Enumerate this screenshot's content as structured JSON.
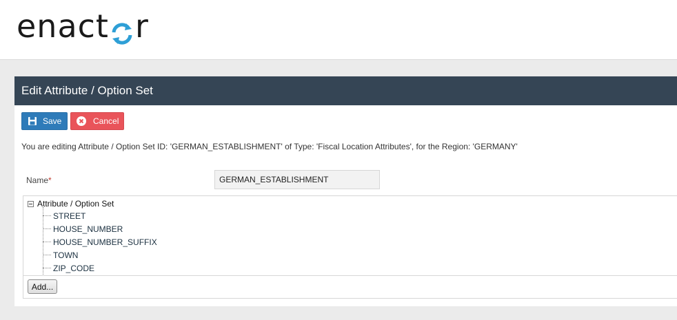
{
  "brand": {
    "logo_text_left": "enact",
    "logo_text_right": "r",
    "logo_color": "#1a1a1a",
    "logo_accent": "#2e9fd6"
  },
  "panel": {
    "title": "Edit Attribute / Option Set",
    "header_bg": "#354555"
  },
  "toolbar": {
    "save_label": "Save",
    "cancel_label": "Cancel",
    "save_icon": "floppy-disk-icon",
    "cancel_icon": "close-circle-icon"
  },
  "info_text": "You are editing Attribute / Option Set ID: 'GERMAN_ESTABLISHMENT' of Type: 'Fiscal Location Attributes', for the Region: 'GERMANY'",
  "form": {
    "name_label": "Name",
    "required_marker": "*",
    "name_value": "GERMAN_ESTABLISHMENT"
  },
  "tree": {
    "root_label": "Attribute / Option Set",
    "items": [
      "STREET",
      "HOUSE_NUMBER",
      "HOUSE_NUMBER_SUFFIX",
      "TOWN",
      "ZIP_CODE"
    ]
  },
  "add_button_label": "Add..."
}
